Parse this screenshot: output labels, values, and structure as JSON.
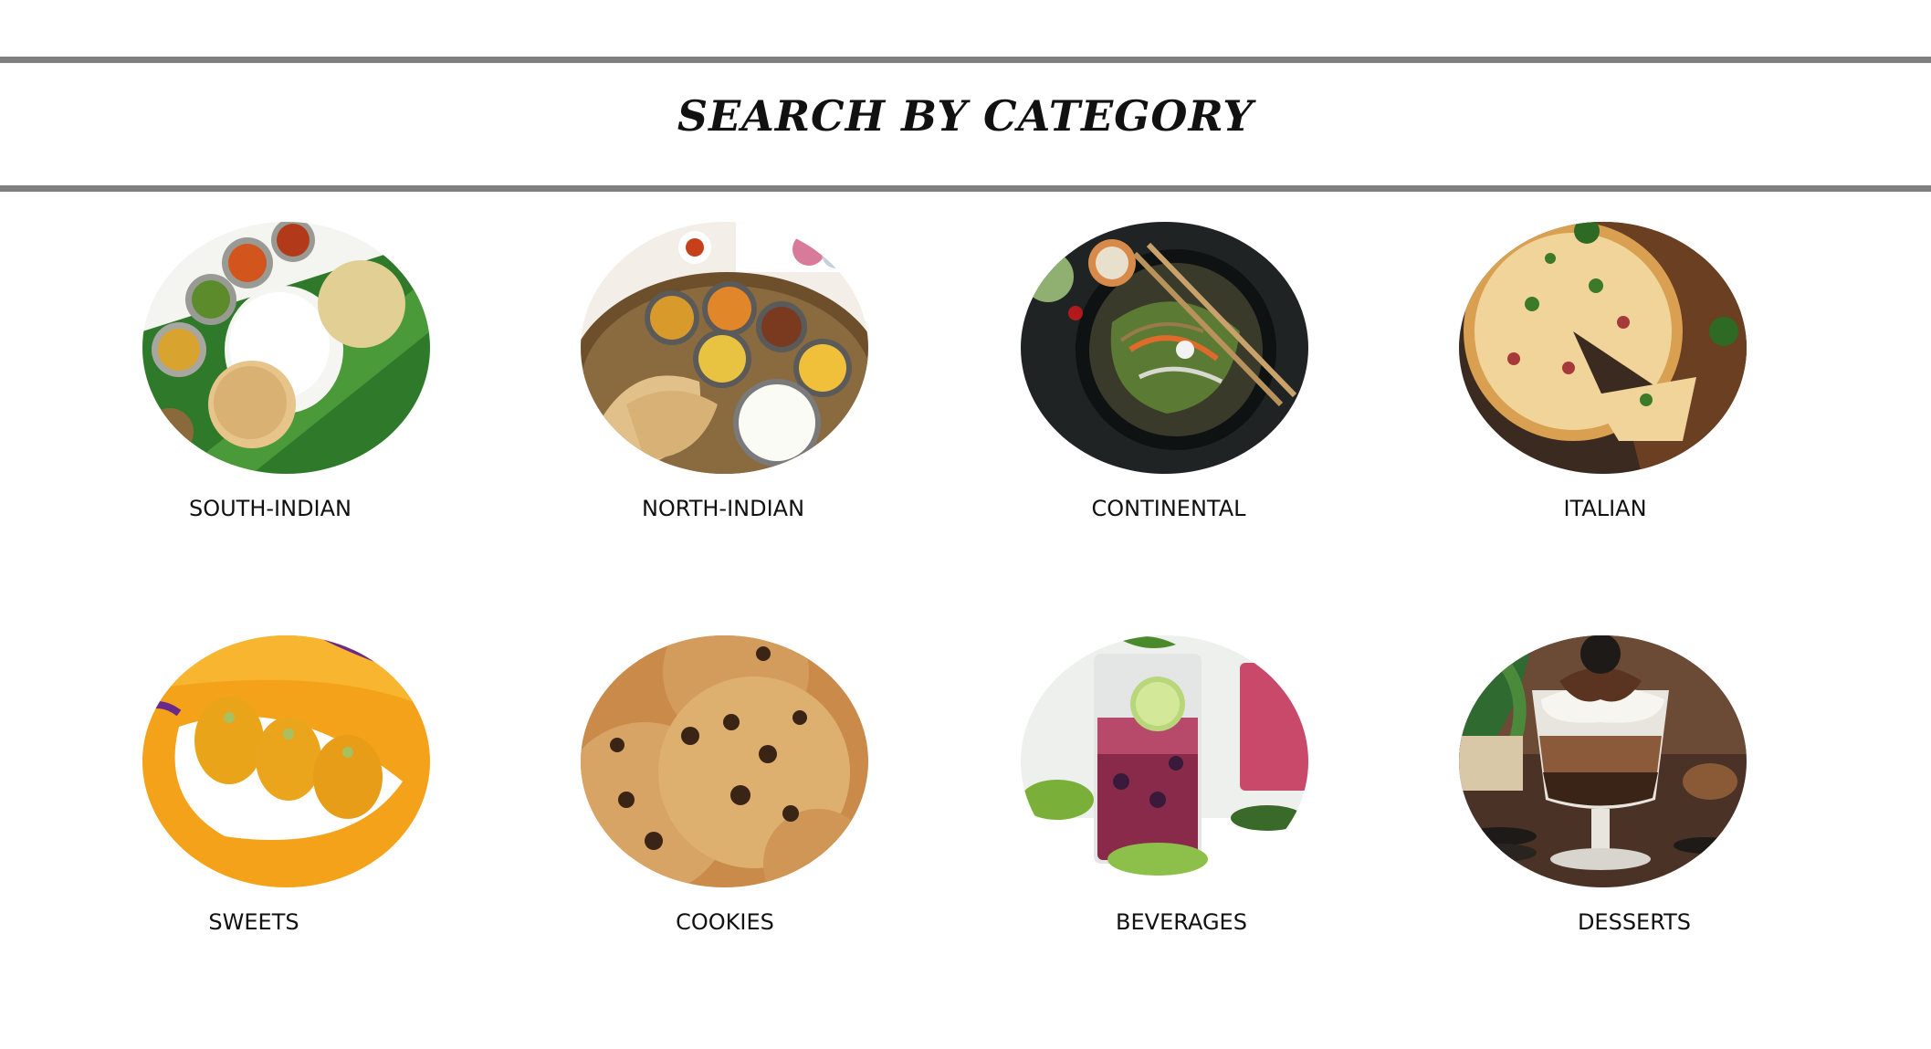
{
  "header": {
    "title": "SEARCH BY CATEGORY"
  },
  "categories": [
    {
      "label": "SOUTH-INDIAN",
      "icon": "south-indian-thali-image"
    },
    {
      "label": "NORTH-INDIAN",
      "icon": "north-indian-thali-image"
    },
    {
      "label": "CONTINENTAL",
      "icon": "noodles-bowl-image"
    },
    {
      "label": "ITALIAN",
      "icon": "pizza-image"
    },
    {
      "label": "SWEETS",
      "icon": "laddu-sweets-image"
    },
    {
      "label": "COOKIES",
      "icon": "chocolate-chip-cookies-image"
    },
    {
      "label": "BEVERAGES",
      "icon": "berry-drink-glass-image"
    },
    {
      "label": "DESSERTS",
      "icon": "oreo-dessert-glass-image"
    }
  ],
  "colors": {
    "rule": "#808080",
    "text": "#111111",
    "background": "#ffffff"
  }
}
